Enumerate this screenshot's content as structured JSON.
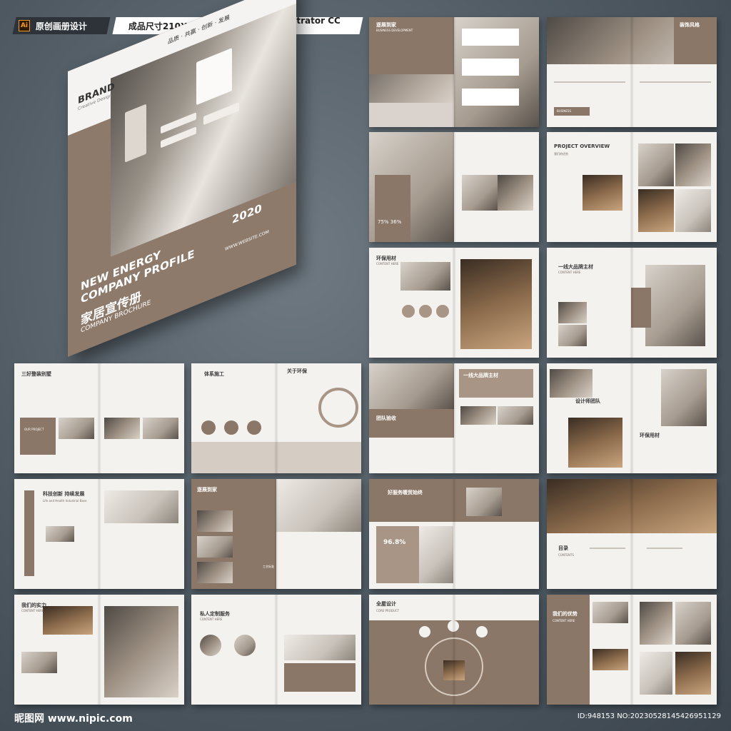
{
  "badges": {
    "original": "原创画册设计",
    "size": "成品尺寸210X285mm",
    "software": "Adobe Illustrator CC 2018",
    "ai_icon": "Ai"
  },
  "cover": {
    "brand": "BRAND",
    "brand_sub": "Creative Design",
    "tagline": "品质 · 共赢 · 创新 · 发展",
    "title_line1": "NEW ENERGY",
    "title_line2": "COMPANY PROFILE",
    "year": "2020",
    "title_cn": "家居宣传册",
    "title_en": "COMPANY BROCHURE",
    "website": "WWW.WEBSITE.COM"
  },
  "spreads": [
    {
      "title": "逐展到家",
      "sub": "BUSINESS DEVELOPMENT"
    },
    {
      "title": "装饰风格",
      "sub": "BUSINESS"
    },
    {
      "title": "",
      "sub": "75%   36%"
    },
    {
      "title": "PROJECT OVERVIEW",
      "sub": "我们的优势"
    },
    {
      "title": "环保用材",
      "sub": "CONTENT HERE"
    },
    {
      "title": "一线大品牌主材",
      "sub": "CONTENT HERE"
    },
    {
      "title": "三好整装别墅",
      "sub": "OUR PROJECT"
    },
    {
      "title": "体系施工",
      "sub": "关于环保"
    },
    {
      "title": "一线大品牌主材",
      "sub": "团队验收"
    },
    {
      "title": "设计师团队",
      "sub": "环保用材"
    },
    {
      "title": "科技创新 持续发展",
      "sub": "Life and Health Industrial Base"
    },
    {
      "title": "逐展到家",
      "sub": "工艺标准"
    },
    {
      "title": "好服务暖贸始终",
      "sub": "96.8%"
    },
    {
      "title": "目录",
      "sub": "CONTENTS"
    },
    {
      "title": "我们的实力",
      "sub": "CONTENT HERE"
    },
    {
      "title": "私人定制服务",
      "sub": "CONTENT HERE"
    },
    {
      "title": "全屋设计",
      "sub": "CORE PRODUCT"
    },
    {
      "title": "我们的优势",
      "sub": "CONTENT HERE"
    }
  ],
  "footer": {
    "logo": "昵图网 www.nipic.com",
    "id": "ID:948153 NO:20230528145426951129"
  }
}
